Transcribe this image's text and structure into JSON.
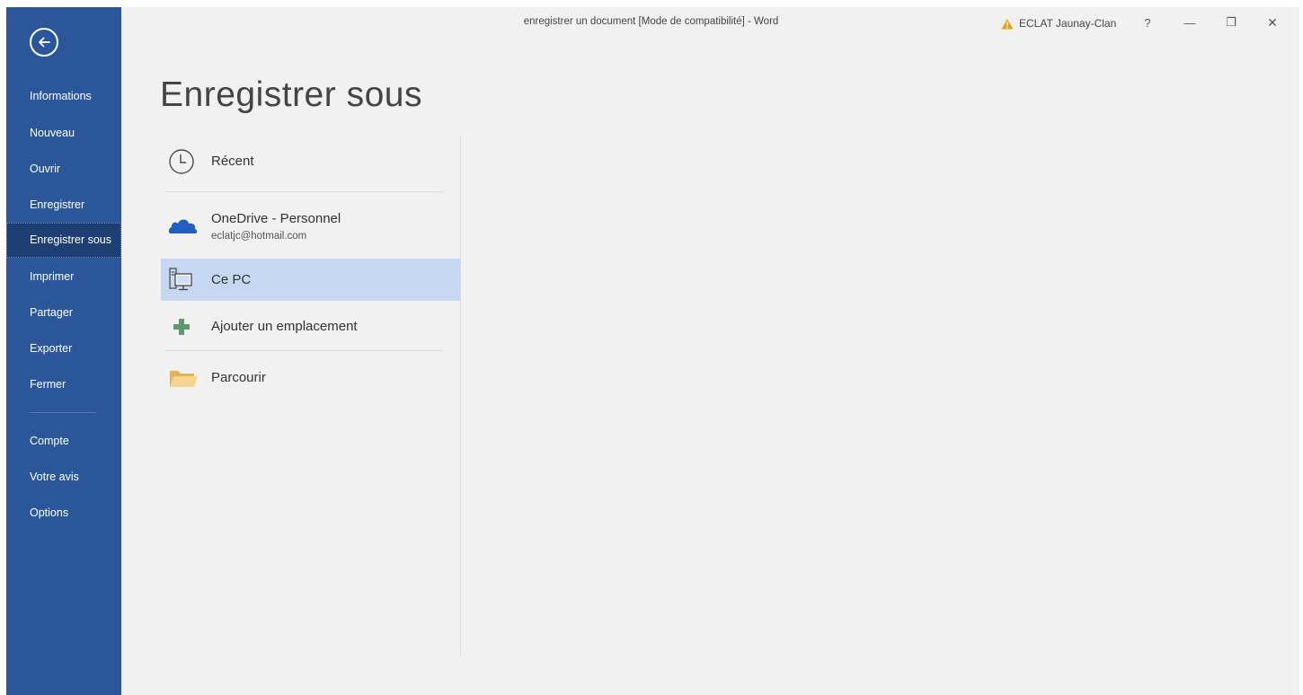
{
  "window": {
    "title": "enregistrer un document [Mode de compatibilité]  -  Word",
    "account_name": "ECLAT Jaunay-Clan",
    "help_label": "?",
    "minimize_label": "—",
    "restore_label": "❐",
    "close_label": "✕"
  },
  "sidebar": {
    "items": [
      {
        "label": "Informations"
      },
      {
        "label": "Nouveau"
      },
      {
        "label": "Ouvrir"
      },
      {
        "label": "Enregistrer"
      },
      {
        "label": "Enregistrer sous",
        "active": true
      },
      {
        "label": "Imprimer"
      },
      {
        "label": "Partager"
      },
      {
        "label": "Exporter"
      },
      {
        "label": "Fermer"
      },
      {
        "label": "Compte"
      },
      {
        "label": "Votre avis"
      },
      {
        "label": "Options"
      }
    ]
  },
  "main": {
    "title": "Enregistrer sous",
    "locations": [
      {
        "label": "Récent",
        "icon": "clock-icon"
      },
      {
        "label": "OneDrive - Personnel",
        "sublabel": "eclatjc@hotmail.com",
        "icon": "onedrive-cloud-icon"
      },
      {
        "label": "Ce PC",
        "icon": "computer-icon",
        "selected": true
      },
      {
        "label": "Ajouter un emplacement",
        "icon": "plus-icon"
      },
      {
        "label": "Parcourir",
        "icon": "folder-icon"
      }
    ]
  },
  "colors": {
    "sidebar": "#2b579a",
    "sidebar_active": "#1e3f73",
    "selected_location": "#c5d7f1",
    "background": "#f1f1f1",
    "warning": "#e8a317"
  }
}
